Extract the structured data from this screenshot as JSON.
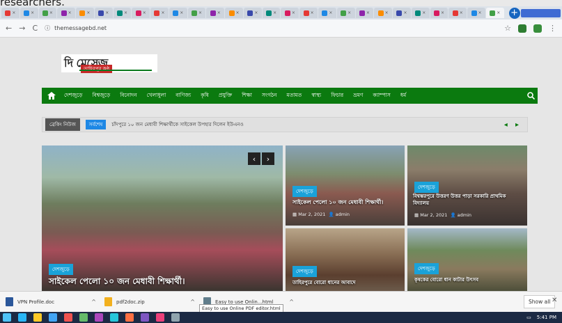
{
  "cut_text": "researchers.",
  "browser": {
    "tab_count": 27,
    "url": "themessagebd.net"
  },
  "site": {
    "logo_main": "দি মেসেজ",
    "logo_sub": "তাহিরপুর কণ্ঠ",
    "nav": [
      "দেশজুড়ে",
      "বিশ্বজুড়ে",
      "বিনোদন",
      "খেলাধুলা",
      "বাণিজ্য",
      "কৃষি",
      "প্রযুক্তি",
      "শিক্ষা",
      "সংগঠন",
      "মতামত",
      "স্বাস্থ্য",
      "ফিচার",
      "ভ্রমণ",
      "ক্যাম্পাস",
      "ধর্ম"
    ],
    "ticker": {
      "label": "ব্রেকিং নিউজ",
      "tag": "সর্বশেষ",
      "text": "চাঁদপুরে ১০ জন মেধাবী শিক্ষার্থীকে সাইকেল উপহার দিলেন ইউএনও"
    },
    "cards": [
      {
        "category": "দেশজুড়ে",
        "title": "সাইকেল পেলো ১০ জন মেধাবী শিক্ষার্থী।",
        "date": "",
        "author": ""
      },
      {
        "category": "দেশজুড়ে",
        "title": "সাইকেল পেলো ১০ জন মেধাবী শিক্ষার্থী।",
        "date": "Mar 2, 2021",
        "author": "admin"
      },
      {
        "category": "দেশজুড়ে",
        "title": "বিশ্বম্ভরপুরে উত্তরণ উত্তর পাড়া সরকারি প্রাথমিক বিদ্যালয়",
        "date": "Mar 2, 2021",
        "author": "admin"
      },
      {
        "category": "দেশজুড়ে",
        "title": "তাহিরপুরে বোরো ধানের আবাদে",
        "date": "",
        "author": ""
      },
      {
        "category": "দেশজুড়ে",
        "title": "কৃষকের বোরো ধান কাটার উৎসব",
        "date": "",
        "author": ""
      }
    ]
  },
  "downloads": {
    "items": [
      {
        "name": "VPN Profile.doc",
        "color": "#2b579a"
      },
      {
        "name": "pdf2doc.zip",
        "color": "#f2b01e"
      },
      {
        "name": "Easy to use Onlin...html",
        "color": "#607d8b"
      }
    ],
    "tooltip": "Easy to use Online PDF editor.html",
    "show_all": "Show all"
  },
  "taskbar": {
    "time": "5:41 PM"
  }
}
